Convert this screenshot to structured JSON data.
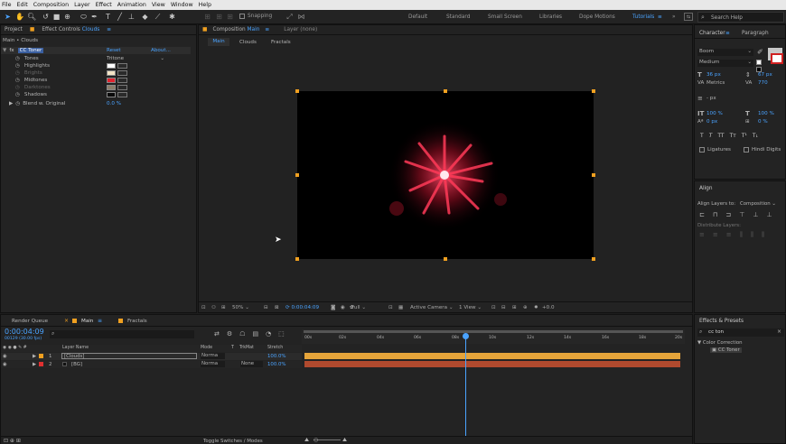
{
  "menu": [
    "File",
    "Edit",
    "Composition",
    "Layer",
    "Effect",
    "Animation",
    "View",
    "Window",
    "Help"
  ],
  "toolbar": {
    "snapping": "Snapping",
    "workspaces": [
      "Default",
      "Standard",
      "Small Screen",
      "Libraries",
      "Dope Motions",
      "Tutorials"
    ],
    "search_placeholder": "Search Help"
  },
  "project_tab": "Project",
  "effect_tab": "Effect Controls",
  "effect_layer": "Clouds",
  "effect_title": "Main • Clouds",
  "effect": {
    "name": "CC Toner",
    "reset": "Reset",
    "about": "About...",
    "tones_label": "Tones",
    "tones_value": "Tritone",
    "props": [
      "Highlights",
      "Brights",
      "Midtones",
      "Darktones",
      "Shadows"
    ],
    "colors": [
      "#ffffff",
      "#f2e4c6",
      "#e0232f",
      "#8a7d6a",
      "#0a0a0a"
    ],
    "blend_label": "Blend w. Original",
    "blend_value": "0.0 %"
  },
  "comp_tab": "Composition",
  "comp_name": "Main",
  "layer_tab": "Layer (none)",
  "comp_breadcrumbs": [
    "Main",
    "Clouds",
    "Fractals"
  ],
  "viewer": {
    "zoom": "50%",
    "timecode": "0:00:04:09",
    "res": "Full",
    "camera": "Active Camera",
    "views": "1 View",
    "exposure": "+0.0"
  },
  "character": {
    "tab": "Character",
    "tab2": "Paragraph",
    "font": "Boom",
    "style": "Medium",
    "size": "36 px",
    "leading": "67 px",
    "kerning": "Metrics",
    "tracking": "770",
    "indent": "- px",
    "vscale": "100 %",
    "hscale": "100 %",
    "baseline": "0 px",
    "tsume": "0 %",
    "ligatures": "Ligatures",
    "hindi": "Hindi Digits"
  },
  "align": {
    "tab": "Align",
    "align_to_label": "Align Layers to:",
    "align_to": "Composition",
    "distribute": "Distribute Layers:"
  },
  "timeline": {
    "render_tab": "Render Queue",
    "main_tab": "Main",
    "fractals_tab": "Fractals",
    "timecode": "0:00:04:09",
    "fps": "00129 (30.00 fps)",
    "col_name": "Layer Name",
    "col_mode": "Mode",
    "col_t": "T",
    "col_trkmat": "TrkMat",
    "col_stretch": "Stretch",
    "rulers": [
      "00s",
      "02s",
      "04s",
      "06s",
      "08s",
      "10s",
      "12s",
      "14s",
      "16s",
      "18s",
      "20s"
    ],
    "layers": [
      {
        "num": "1",
        "name": "[Clouds]",
        "mode": "Norma",
        "trk": "",
        "stretch": "100.0%"
      },
      {
        "num": "2",
        "name": "[BG]",
        "mode": "Norma",
        "trk": "None",
        "stretch": "100.0%"
      }
    ],
    "toggle": "Toggle Switches / Modes"
  },
  "effects_presets": {
    "tab": "Effects & Presets",
    "search": "cc ton",
    "category": "Color Correction",
    "item": "CC Toner"
  }
}
